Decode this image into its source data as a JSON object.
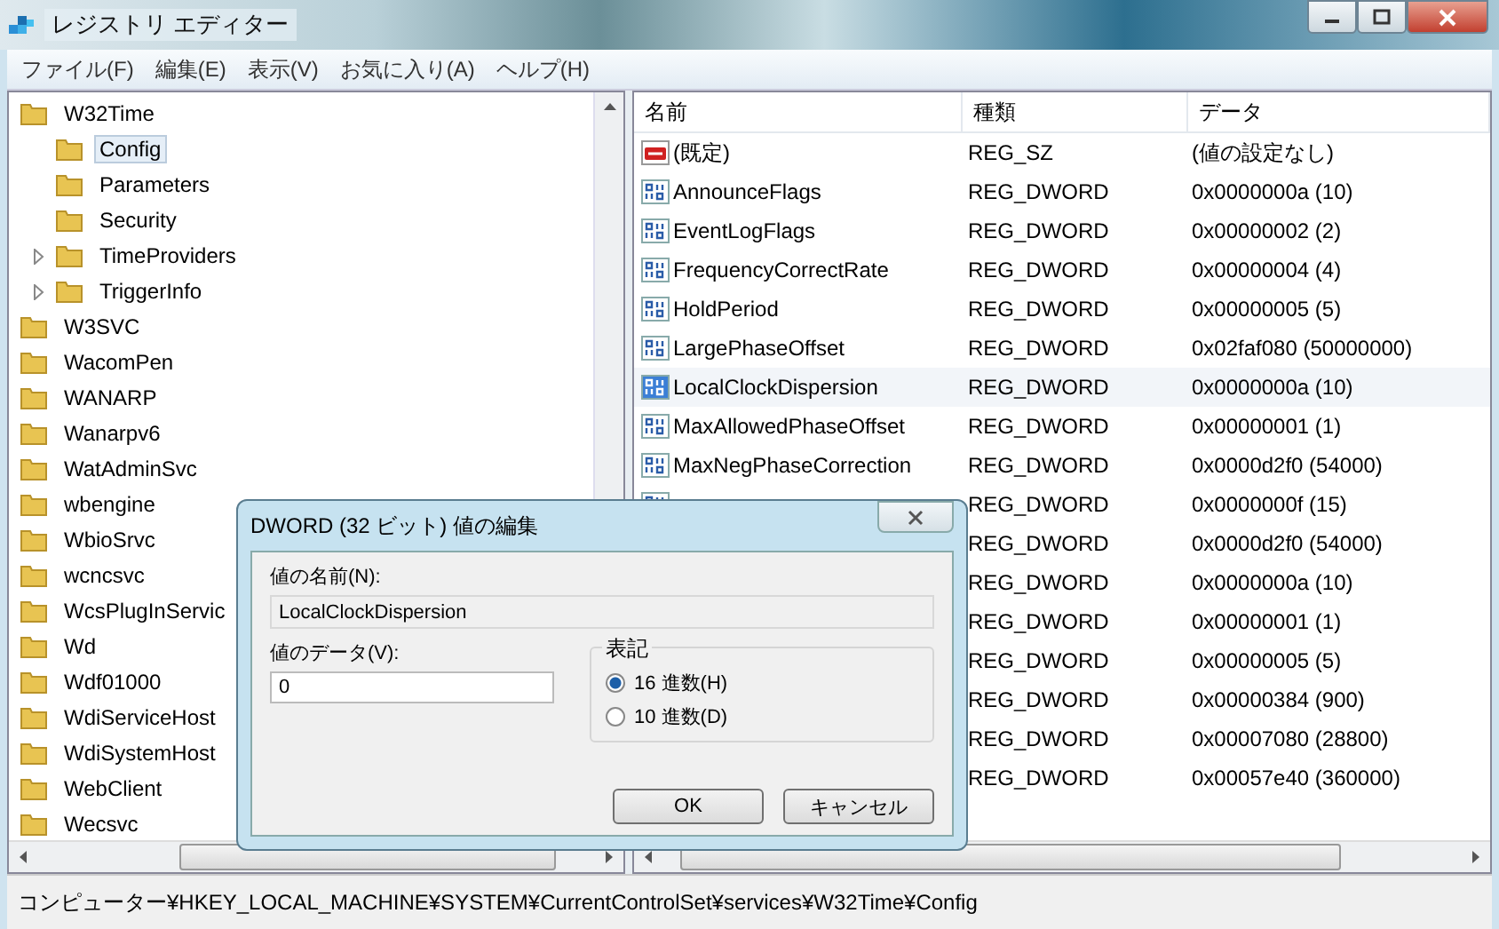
{
  "window": {
    "title": "レジストリ エディター"
  },
  "menu": [
    "ファイル(F)",
    "編集(E)",
    "表示(V)",
    "お気に入り(A)",
    "ヘルプ(H)"
  ],
  "tree": [
    {
      "label": "W32Time",
      "selected": false,
      "children": [
        {
          "label": "Config",
          "selected": true,
          "has_subkeys": false
        },
        {
          "label": "Parameters",
          "selected": false,
          "has_subkeys": false
        },
        {
          "label": "Security",
          "selected": false,
          "has_subkeys": false
        },
        {
          "label": "TimeProviders",
          "selected": false,
          "has_subkeys": true
        },
        {
          "label": "TriggerInfo",
          "selected": false,
          "has_subkeys": true
        }
      ]
    },
    {
      "label": "W3SVC",
      "selected": false
    },
    {
      "label": "WacomPen",
      "selected": false
    },
    {
      "label": "WANARP",
      "selected": false
    },
    {
      "label": "Wanarpv6",
      "selected": false
    },
    {
      "label": "WatAdminSvc",
      "selected": false
    },
    {
      "label": "wbengine",
      "selected": false
    },
    {
      "label": "WbioSrvc",
      "selected": false
    },
    {
      "label": "wcncsvc",
      "selected": false
    },
    {
      "label": "WcsPlugInServic",
      "selected": false
    },
    {
      "label": "Wd",
      "selected": false
    },
    {
      "label": "Wdf01000",
      "selected": false
    },
    {
      "label": "WdiServiceHost",
      "selected": false
    },
    {
      "label": "WdiSystemHost",
      "selected": false
    },
    {
      "label": "WebClient",
      "selected": false
    },
    {
      "label": "Wecsvc",
      "selected": false
    }
  ],
  "table": {
    "columns": [
      "名前",
      "種類",
      "データ"
    ],
    "rows": [
      {
        "kind": "sz",
        "name": "(既定)",
        "type": "REG_SZ",
        "data": "(値の設定なし)",
        "selected": false
      },
      {
        "kind": "dword",
        "name": "AnnounceFlags",
        "type": "REG_DWORD",
        "data": "0x0000000a (10)",
        "selected": false
      },
      {
        "kind": "dword",
        "name": "EventLogFlags",
        "type": "REG_DWORD",
        "data": "0x00000002 (2)",
        "selected": false
      },
      {
        "kind": "dword",
        "name": "FrequencyCorrectRate",
        "type": "REG_DWORD",
        "data": "0x00000004 (4)",
        "selected": false
      },
      {
        "kind": "dword",
        "name": "HoldPeriod",
        "type": "REG_DWORD",
        "data": "0x00000005 (5)",
        "selected": false
      },
      {
        "kind": "dword",
        "name": "LargePhaseOffset",
        "type": "REG_DWORD",
        "data": "0x02faf080 (50000000)",
        "selected": false
      },
      {
        "kind": "dword",
        "name": "LocalClockDispersion",
        "type": "REG_DWORD",
        "data": "0x0000000a (10)",
        "selected": true
      },
      {
        "kind": "dword",
        "name": "MaxAllowedPhaseOffset",
        "type": "REG_DWORD",
        "data": "0x00000001 (1)",
        "selected": false
      },
      {
        "kind": "dword",
        "name": "MaxNegPhaseCorrection",
        "type": "REG_DWORD",
        "data": "0x0000d2f0 (54000)",
        "selected": false
      },
      {
        "kind": "dword",
        "type": "REG_DWORD",
        "data": "0x0000000f (15)",
        "selected": false
      },
      {
        "kind": "dword",
        "type": "REG_DWORD",
        "data": "0x0000d2f0 (54000)",
        "selected": false
      },
      {
        "kind": "dword",
        "type": "REG_DWORD",
        "data": "0x0000000a (10)",
        "selected": false
      },
      {
        "kind": "dword",
        "type": "REG_DWORD",
        "data": "0x00000001 (1)",
        "selected": false
      },
      {
        "kind": "dword",
        "type": "REG_DWORD",
        "data": "0x00000005 (5)",
        "selected": false
      },
      {
        "kind": "dword",
        "type": "REG_DWORD",
        "data": "0x00000384 (900)",
        "selected": false
      },
      {
        "kind": "dword",
        "type": "REG_DWORD",
        "data": "0x00007080 (28800)",
        "selected": false
      },
      {
        "kind": "dword",
        "type": "REG_DWORD",
        "data": "0x00057e40 (360000)",
        "selected": false
      }
    ]
  },
  "dialog": {
    "title": "DWORD (32 ビット) 値の編集",
    "name_label": "値の名前(N):",
    "name_value": "LocalClockDispersion",
    "data_label": "値のデータ(V):",
    "data_value": "0",
    "base_group": "表記",
    "radios": [
      {
        "label": "16 進数(H)",
        "selected": true
      },
      {
        "label": "10 進数(D)",
        "selected": false
      }
    ],
    "buttons": [
      "OK",
      "キャンセル"
    ]
  },
  "status_bar": "コンピューター¥HKEY_LOCAL_MACHINE¥SYSTEM¥CurrentControlSet¥services¥W32Time¥Config"
}
